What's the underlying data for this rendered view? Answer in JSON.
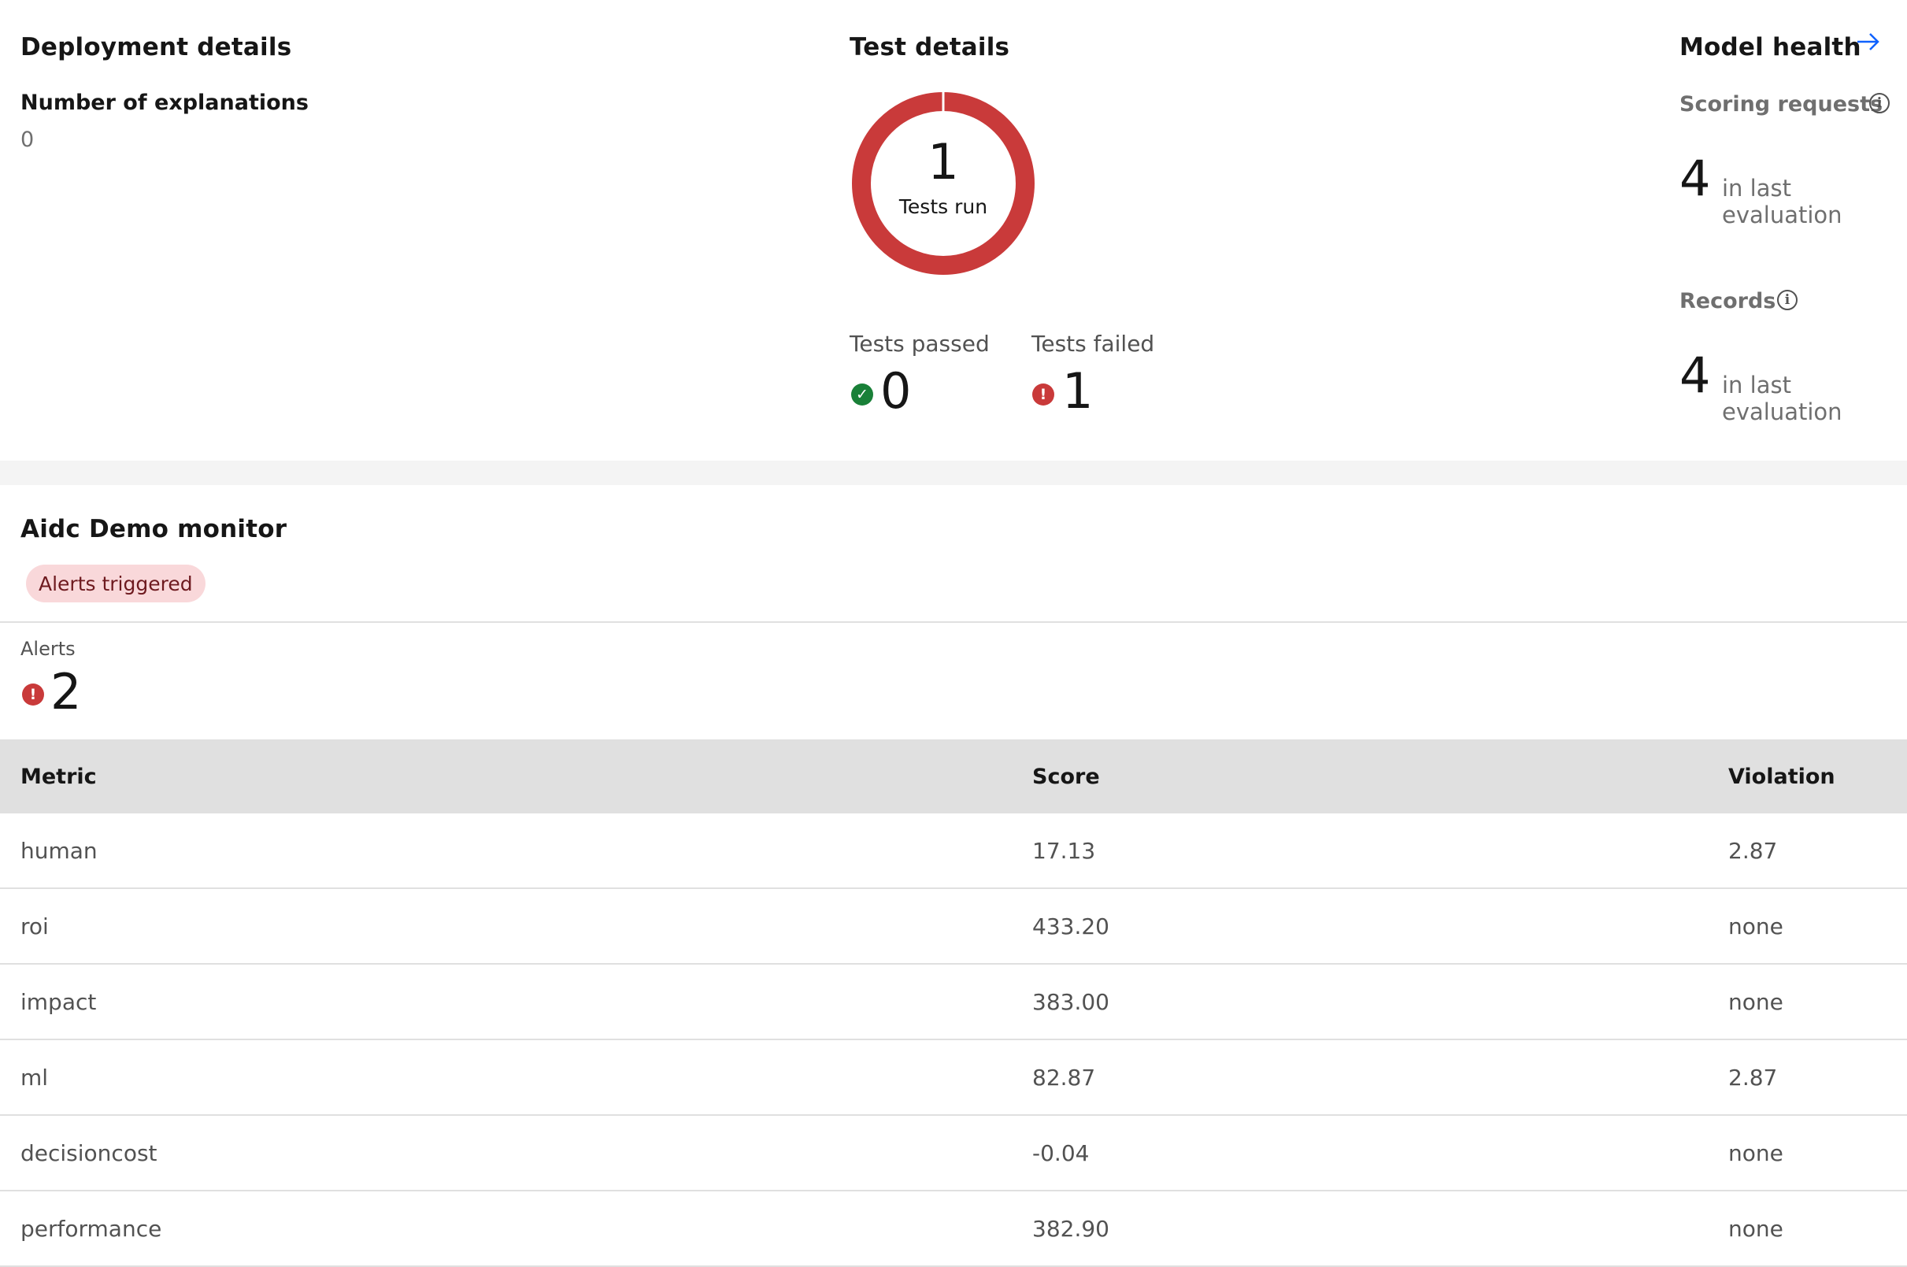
{
  "deployment": {
    "title": "Deployment details",
    "explanations_label": "Number of explanations",
    "explanations_value": "0"
  },
  "tests": {
    "title": "Test details",
    "run_count": "1",
    "run_label": "Tests run",
    "passed_label": "Tests passed",
    "passed_value": "0",
    "failed_label": "Tests failed",
    "failed_value": "1",
    "failed_fraction": 1.0,
    "colors": {
      "failed": "#c93a3a",
      "passed": "#198038"
    }
  },
  "health": {
    "title": "Model health",
    "link_icon": "arrow-right-icon",
    "scoring_label": "Scoring requests",
    "scoring_value": "4",
    "scoring_suffix": "in last evaluation",
    "records_label": "Records",
    "records_value": "4",
    "records_suffix": "in last evaluation"
  },
  "monitor": {
    "title": "Aidc Demo monitor",
    "tag": "Alerts triggered",
    "alerts_label": "Alerts",
    "alerts_value": "2"
  },
  "table": {
    "headers": [
      "Metric",
      "Score",
      "Violation"
    ],
    "rows": [
      [
        "human",
        "17.13",
        "2.87"
      ],
      [
        "roi",
        "433.20",
        "none"
      ],
      [
        "impact",
        "383.00",
        "none"
      ],
      [
        "ml",
        "82.87",
        "2.87"
      ],
      [
        "decisioncost",
        "-0.04",
        "none"
      ],
      [
        "performance",
        "382.90",
        "none"
      ]
    ]
  }
}
